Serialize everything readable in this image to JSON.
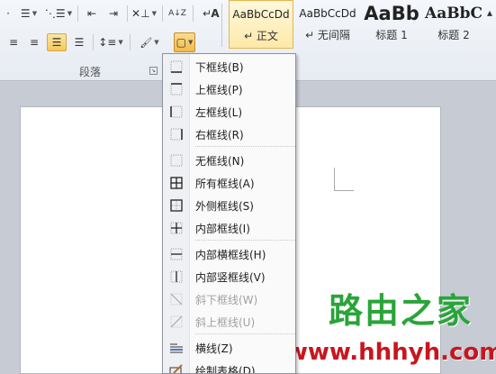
{
  "ribbon": {
    "group_label": "段落",
    "buttons": {
      "bullets": "☰",
      "numbering": "⋮☰",
      "multilevel": "⋱☰",
      "decrease_indent": "⇤",
      "increase_indent": "⇥",
      "chinese_layout": "✕⊥",
      "sort": "A↓Z",
      "show_marks": "↵",
      "align_center": "≡",
      "align_right": "≡",
      "justify": "☰",
      "distributed": "☰",
      "line_spacing": "↕≡",
      "shading": "🖌",
      "borders": "▢",
      "font_color_partial": "A"
    }
  },
  "styles": [
    {
      "sample": "AaBbCcDd",
      "name": "↵ 正文",
      "selected": true
    },
    {
      "sample": "AaBbCcDd",
      "name": "↵ 无间隔",
      "selected": false
    },
    {
      "sample": "AaBb",
      "name": "标题 1",
      "selected": false
    },
    {
      "sample": "AaBbC",
      "name": "标题 2",
      "selected": false
    }
  ],
  "border_menu": {
    "items": [
      {
        "label": "下框线(B)",
        "icon": "bottom-border-icon",
        "disabled": false
      },
      {
        "label": "上框线(P)",
        "icon": "top-border-icon",
        "disabled": false
      },
      {
        "label": "左框线(L)",
        "icon": "left-border-icon",
        "disabled": false
      },
      {
        "label": "右框线(R)",
        "icon": "right-border-icon",
        "disabled": false
      },
      {
        "label": "无框线(N)",
        "icon": "no-border-icon",
        "disabled": false
      },
      {
        "label": "所有框线(A)",
        "icon": "all-borders-icon",
        "disabled": false
      },
      {
        "label": "外侧框线(S)",
        "icon": "outside-borders-icon",
        "disabled": false
      },
      {
        "label": "内部框线(I)",
        "icon": "inside-borders-icon",
        "disabled": false
      },
      {
        "label": "内部横框线(H)",
        "icon": "inside-horizontal-border-icon",
        "disabled": false
      },
      {
        "label": "内部竖框线(V)",
        "icon": "inside-vertical-border-icon",
        "disabled": false
      },
      {
        "label": "斜下框线(W)",
        "icon": "diagonal-down-border-icon",
        "disabled": true
      },
      {
        "label": "斜上框线(U)",
        "icon": "diagonal-up-border-icon",
        "disabled": true
      },
      {
        "label": "横线(Z)",
        "icon": "horizontal-line-icon",
        "disabled": false
      },
      {
        "label": "绘制表格(D)",
        "icon": "draw-table-icon",
        "disabled": false
      }
    ]
  },
  "watermark": {
    "brand": "路由之家",
    "url": "(www.hhhyh.com)"
  }
}
